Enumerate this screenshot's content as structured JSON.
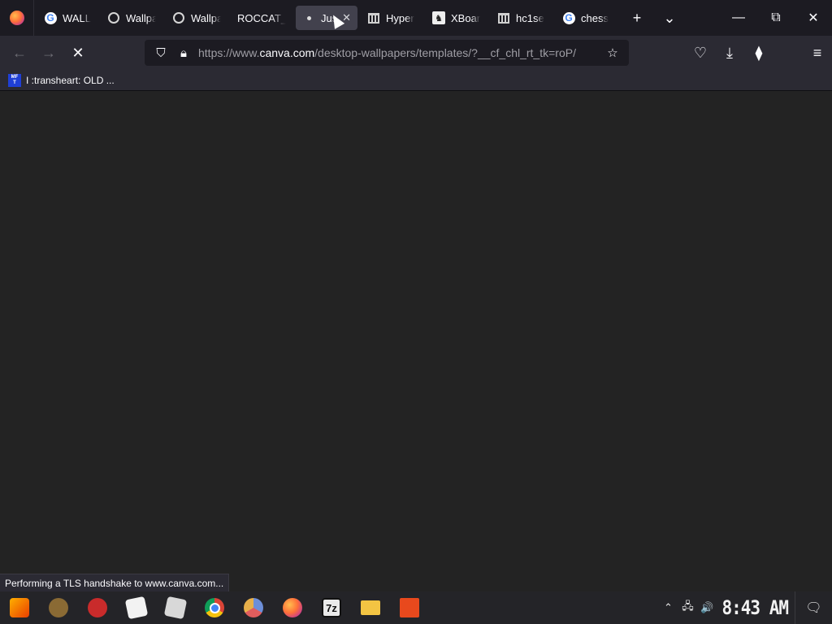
{
  "browser": {
    "tabs": [
      {
        "title": "WALLP",
        "icon": "google-icon",
        "active": false
      },
      {
        "title": "Wallpa",
        "icon": "globe-icon",
        "active": false
      },
      {
        "title": "Wallpa",
        "icon": "globe-icon",
        "active": false
      },
      {
        "title": "ROCCAT_",
        "icon": "",
        "active": false
      },
      {
        "title": "Jus",
        "icon": "loading-dot-icon",
        "active": true
      },
      {
        "title": "Hyper",
        "icon": "institution-icon",
        "active": false
      },
      {
        "title": "XBoar",
        "icon": "xboard-icon",
        "active": false
      },
      {
        "title": "hc1se",
        "icon": "institution-icon",
        "active": false
      },
      {
        "title": "chess",
        "icon": "google-icon",
        "active": false
      }
    ],
    "new_tab_symbol": "+",
    "tab_list_symbol": "⌄",
    "window_controls": {
      "minimize": "—",
      "restore": "⧉",
      "close": "✕"
    }
  },
  "navbar": {
    "back_symbol": "←",
    "forward_symbol": "→",
    "stop_symbol": "✕",
    "url_prefix": "https://www.",
    "url_domain": "canva.com",
    "url_path": "/desktop-wallpapers/templates/?__cf_chl_rt_tk=roP/",
    "actions": {
      "pocket": "♡",
      "downloads": "⤓",
      "extensions": "⧫",
      "menu": "≡"
    }
  },
  "bookmarks": [
    {
      "label": "I :transheart: OLD ...",
      "icon_text_top": "MF",
      "icon_text_bottom": "T"
    }
  ],
  "status": {
    "text": "Performing a TLS handshake to www.canva.com..."
  },
  "taskbar": {
    "apps": [
      "start-icon",
      "monkey-app-icon",
      "red-ball-app-icon",
      "dice-app-icon",
      "dice2-app-icon",
      "chrome-icon",
      "chromium-icon",
      "firefox-icon",
      "7zip-icon",
      "file-explorer-icon",
      "office-icon"
    ],
    "seven_zip_label": "7z",
    "clock": "8:43 AM",
    "tray": {
      "chevron": "⌃",
      "network": "🖧",
      "volume": "🔊",
      "notifications": "🗨"
    }
  }
}
